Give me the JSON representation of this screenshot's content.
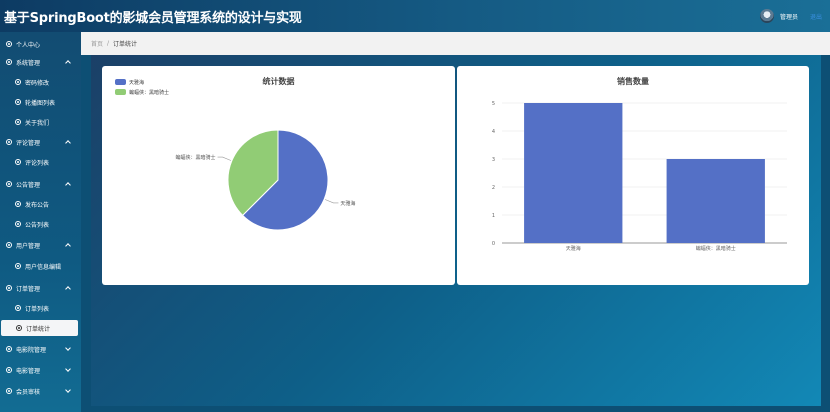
{
  "header": {
    "title": "基于SpringBoot的影城会员管理系统的设计与实现",
    "admin_label": "管理员",
    "exit_label": "退出"
  },
  "sidebar": {
    "items": [
      {
        "label": "个人中心",
        "level": "group",
        "chevron": "none"
      },
      {
        "label": "系统管理",
        "level": "group",
        "chevron": "up"
      },
      {
        "label": "密码修改",
        "level": "sub"
      },
      {
        "label": "轮播图列表",
        "level": "sub"
      },
      {
        "label": "关于我们",
        "level": "sub"
      },
      {
        "label": "评论管理",
        "level": "group",
        "chevron": "up"
      },
      {
        "label": "评论列表",
        "level": "sub"
      },
      {
        "label": "公告管理",
        "level": "group",
        "chevron": "up"
      },
      {
        "label": "发布公告",
        "level": "sub"
      },
      {
        "label": "公告列表",
        "level": "sub"
      },
      {
        "label": "用户管理",
        "level": "group",
        "chevron": "up"
      },
      {
        "label": "用户信息编辑",
        "level": "sub"
      },
      {
        "label": "订单管理",
        "level": "group",
        "chevron": "up"
      },
      {
        "label": "订单列表",
        "level": "sub"
      },
      {
        "label": "订单统计",
        "level": "sub",
        "active": true
      },
      {
        "label": "电影院管理",
        "level": "group",
        "chevron": "down"
      },
      {
        "label": "电影管理",
        "level": "group",
        "chevron": "down"
      },
      {
        "label": "会员审核",
        "level": "group",
        "chevron": "down"
      }
    ]
  },
  "breadcrumb": {
    "home": "首页",
    "separator": "/",
    "current": "订单统计"
  },
  "chart_data": [
    {
      "type": "pie",
      "title": "统计数据",
      "labels": [
        "天雅海",
        "蝙蝠侠：黑暗骑士"
      ],
      "values": [
        5,
        3
      ],
      "colors": [
        "#5470c6",
        "#91cc75"
      ],
      "legend_placement": "top-left"
    },
    {
      "type": "bar",
      "title": "销售数量",
      "categories": [
        "天雅海",
        "蝙蝠侠：黑暗骑士"
      ],
      "values": [
        5,
        3
      ],
      "ylim": [
        0,
        5
      ],
      "yticks": [
        "0",
        "1",
        "2",
        "3",
        "4",
        "5"
      ],
      "grid": true,
      "color": "#5470c6"
    }
  ]
}
